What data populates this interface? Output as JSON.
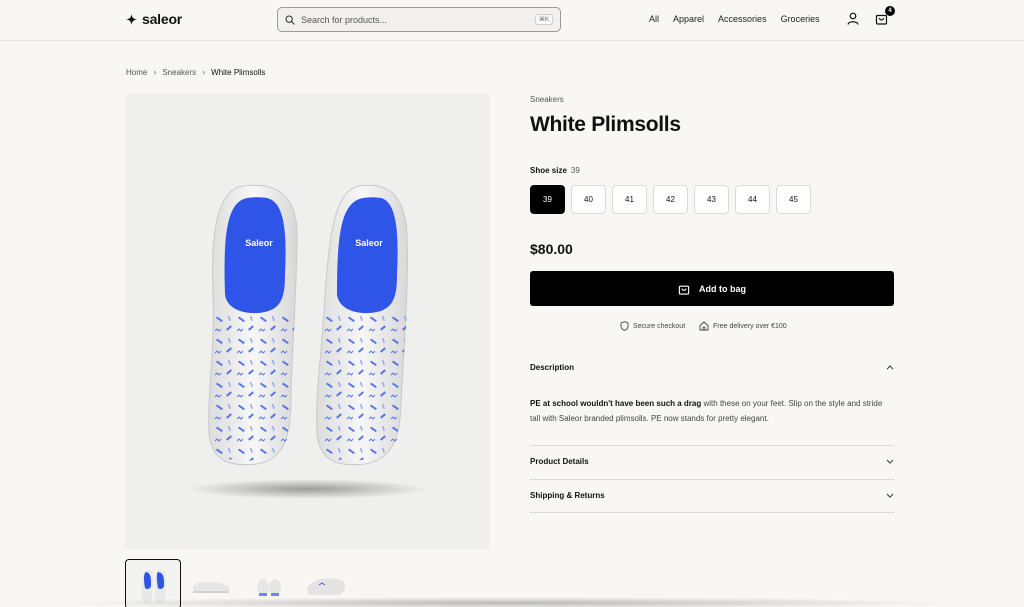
{
  "header": {
    "logo_text": "saleor",
    "search_placeholder": "Search for products...",
    "search_shortcut": "⌘K",
    "nav": [
      "All",
      "Apparel",
      "Accessories",
      "Groceries"
    ],
    "cart_count": "4"
  },
  "breadcrumb": [
    "Home",
    "Sneakers",
    "White Plimsolls"
  ],
  "product": {
    "category": "Sneakers",
    "title": "White Plimsolls",
    "size_label": "Shoe size",
    "selected_size": "39",
    "sizes": [
      "39",
      "40",
      "41",
      "42",
      "43",
      "44",
      "45"
    ],
    "price": "$80.00",
    "add_to_bag": "Add to bag",
    "secure_checkout": "Secure checkout",
    "free_delivery": "Free delivery over €100",
    "image_brand_text": "Saleor"
  },
  "accordion": {
    "description_title": "Description",
    "description_bold": "PE at school wouldn't have been such a drag",
    "description_rest": " with these on your feet. Slip on the style and stride tall with Saleor branded plimsolls. PE now stands for pretty elegant.",
    "product_details_title": "Product Details",
    "shipping_title": "Shipping & Returns"
  },
  "colors": {
    "accent": "#000000",
    "insole_blue": "#2f55e8",
    "background": "#f8f7f4"
  }
}
